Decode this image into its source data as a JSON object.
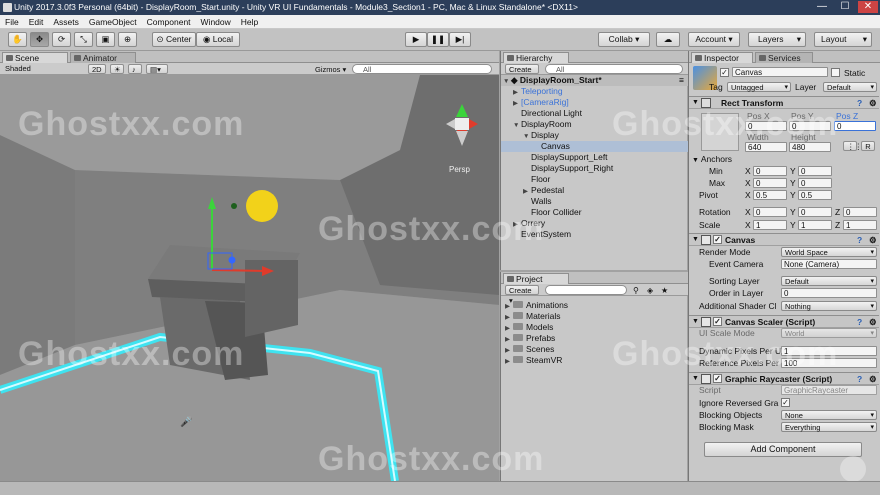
{
  "window": {
    "title": "Unity 2017.3.0f3 Personal (64bit) - DisplayRoom_Start.unity - Unity VR UI Fundamentals - Module3_Section1 - PC, Mac & Linux Standalone* <DX11>",
    "min": "—",
    "max": "☐",
    "close": "✕"
  },
  "menu": [
    "File",
    "Edit",
    "Assets",
    "GameObject",
    "Component",
    "Window",
    "Help"
  ],
  "toolbar": {
    "pivot_label": "Center",
    "space_label": "Local",
    "collab_label": "Collab ▾",
    "account_label": "Account ▾",
    "layers_label": "Layers",
    "layout_label": "Layout"
  },
  "scene": {
    "tab_scene": "Scene",
    "tab_animator": "Animator",
    "shading": "Shaded",
    "mode_2d": "2D",
    "gizmos": "Gizmos",
    "search_placeholder": "All",
    "persp_label": "Persp"
  },
  "hierarchy": {
    "tab": "Hierarchy",
    "create": "Create",
    "search_placeholder": "All",
    "scene_name": "DisplayRoom_Start*",
    "items": [
      {
        "label": "Teleporting",
        "indent": 1,
        "arrow": "▶",
        "blue": true
      },
      {
        "label": "[CameraRig]",
        "indent": 1,
        "arrow": "▶",
        "blue": true
      },
      {
        "label": "Directional Light",
        "indent": 1,
        "arrow": "",
        "blue": false
      },
      {
        "label": "DisplayRoom",
        "indent": 1,
        "arrow": "▼",
        "blue": false
      },
      {
        "label": "Display",
        "indent": 2,
        "arrow": "▼",
        "blue": false
      },
      {
        "label": "Canvas",
        "indent": 3,
        "arrow": "",
        "blue": false,
        "selected": true
      },
      {
        "label": "DisplaySupport_Left",
        "indent": 2,
        "arrow": "",
        "blue": false
      },
      {
        "label": "DisplaySupport_Right",
        "indent": 2,
        "arrow": "",
        "blue": false
      },
      {
        "label": "Floor",
        "indent": 2,
        "arrow": "",
        "blue": false
      },
      {
        "label": "Pedestal",
        "indent": 2,
        "arrow": "▶",
        "blue": false
      },
      {
        "label": "Walls",
        "indent": 2,
        "arrow": "",
        "blue": false
      },
      {
        "label": "Floor Collider",
        "indent": 2,
        "arrow": "",
        "blue": false
      },
      {
        "label": "Orrery",
        "indent": 1,
        "arrow": "▶",
        "blue": false
      },
      {
        "label": "EventSystem",
        "indent": 1,
        "arrow": "",
        "blue": false
      }
    ]
  },
  "project": {
    "tab": "Project",
    "create": "Create",
    "folders": [
      "Animations",
      "Materials",
      "Models",
      "Prefabs",
      "Scenes",
      "SteamVR"
    ]
  },
  "inspector": {
    "tab_inspector": "Inspector",
    "tab_services": "Services",
    "object_name": "Canvas",
    "static_label": "Static",
    "tag_label": "Tag",
    "tag_value": "Untagged",
    "layer_label": "Layer",
    "layer_value": "Default",
    "rect": {
      "title": "Rect Transform",
      "posx_label": "Pos X",
      "posy_label": "Pos Y",
      "posz_label": "Pos Z",
      "posx": "0",
      "posy": "0",
      "posz": "0",
      "width_label": "Width",
      "height_label": "Height",
      "width": "640",
      "height": "480",
      "r_label": "R",
      "anchors_label": "Anchors",
      "min_label": "Min",
      "max_label": "Max",
      "pivot_label": "Pivot",
      "min_x": "0",
      "min_y": "0",
      "max_x": "0",
      "max_y": "0",
      "pivot_x": "0.5",
      "pivot_y": "0.5",
      "rotation_label": "Rotation",
      "rot_x": "0",
      "rot_y": "0",
      "rot_z": "0",
      "scale_label": "Scale",
      "scale_x": "1",
      "scale_y": "1",
      "scale_z": "1",
      "x": "X",
      "y": "Y",
      "z": "Z"
    },
    "canvas": {
      "title": "Canvas",
      "render_mode_label": "Render Mode",
      "render_mode": "World Space",
      "event_camera_label": "Event Camera",
      "event_camera": "None (Camera)",
      "sorting_layer_label": "Sorting Layer",
      "sorting_layer": "Default",
      "order_label": "Order in Layer",
      "order": "0",
      "shader_label": "Additional Shader Cl",
      "shader": "Nothing"
    },
    "scaler": {
      "title": "Canvas Scaler (Script)",
      "ui_scale_label": "UI Scale Mode",
      "ui_scale": "World",
      "dynamic_label": "Dynamic Pixels Per U",
      "dynamic": "1",
      "reference_label": "Reference Pixels Per",
      "reference": "100"
    },
    "raycaster": {
      "title": "Graphic Raycaster (Script)",
      "script_label": "Script",
      "script": "GraphicRaycaster",
      "ignore_label": "Ignore Reversed Gra",
      "blocking_objects_label": "Blocking Objects",
      "blocking_objects": "None",
      "blocking_mask_label": "Blocking Mask",
      "blocking_mask": "Everything"
    },
    "add_component": "Add Component"
  },
  "watermark": "Ghostxx.com",
  "colors": {
    "accent_blue": "#3a72d8",
    "floor_glow": "#3fe3f0",
    "sun": "#f2d21a",
    "selection": "#aebfd6"
  }
}
